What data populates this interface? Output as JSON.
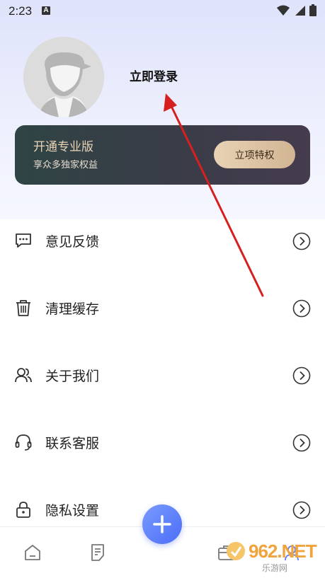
{
  "status_bar": {
    "time": "2:23",
    "notification_glyph": "A"
  },
  "profile": {
    "login_label": "立即登录"
  },
  "vip_card": {
    "title": "开通专业版",
    "subtitle": "享众多独家权益",
    "button_label": "立项特权"
  },
  "menu": {
    "items": [
      {
        "label": "意见反馈",
        "icon": "feedback-icon"
      },
      {
        "label": "清理缓存",
        "icon": "trash-icon"
      },
      {
        "label": "关于我们",
        "icon": "people-icon"
      },
      {
        "label": "联系客服",
        "icon": "headset-icon"
      },
      {
        "label": "隐私设置",
        "icon": "lock-icon"
      }
    ]
  },
  "watermark": {
    "brand": "962.NET",
    "caption": "乐游网"
  },
  "colors": {
    "accent": "#4b6df7",
    "vip_gold": "#e9d3b6",
    "annotation_arrow": "#d62020"
  }
}
